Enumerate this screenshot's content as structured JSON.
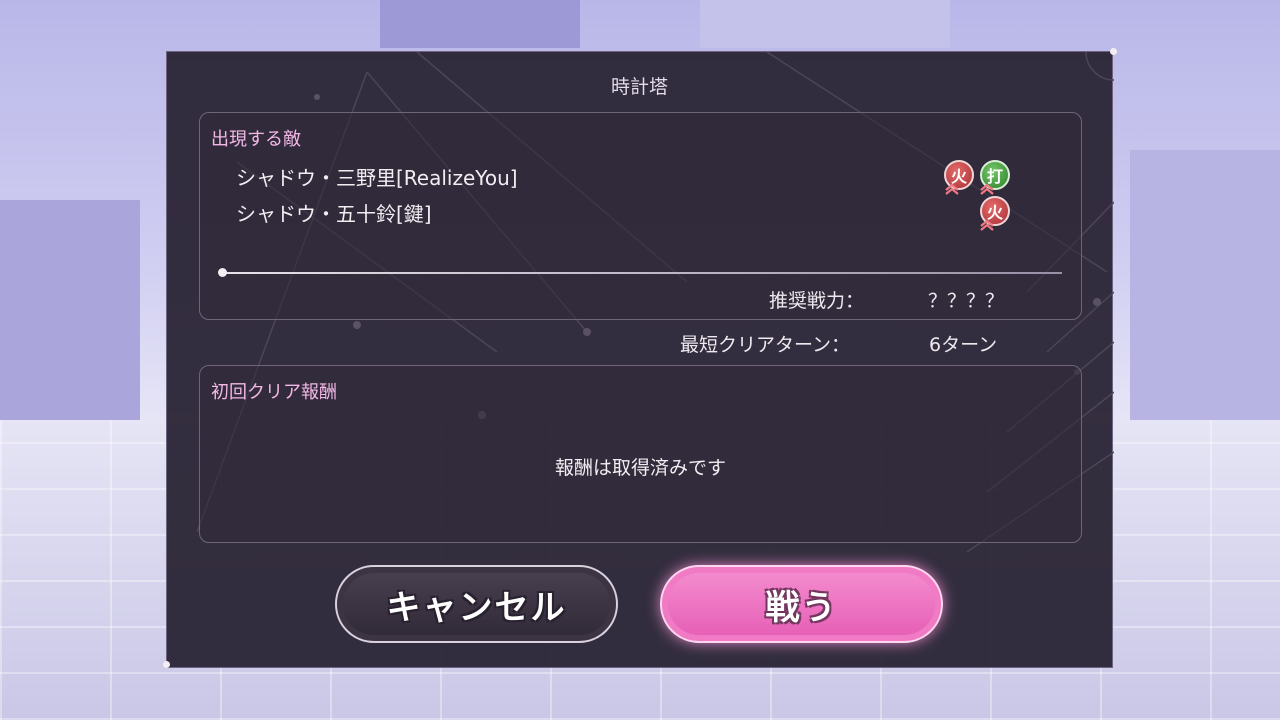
{
  "dialog": {
    "title": "時計塔",
    "enemies_label": "出現する敵",
    "enemies": [
      {
        "name": "シャドウ・三野里[RealizeYou]",
        "attributes": [
          {
            "glyph": "火",
            "type": "fire",
            "weak": true
          },
          {
            "glyph": "打",
            "type": "strike",
            "weak": true
          }
        ]
      },
      {
        "name": "シャドウ・五十鈴[鍵]",
        "attributes": [
          {
            "glyph": "火",
            "type": "fire",
            "weak": true
          }
        ]
      }
    ],
    "recommended_power_label": "推奨戦力：",
    "recommended_power_value": "？？？？",
    "shortest_clear_label": "最短クリアターン：",
    "shortest_clear_value": "6ターン",
    "first_reward_label": "初回クリア報酬",
    "first_reward_message": "報酬は取得済みです"
  },
  "buttons": {
    "cancel_label": "キャンセル",
    "fight_label": "戦う"
  },
  "colors": {
    "panel_bg": "#262030",
    "section_label": "#f3b8e6",
    "fight_button": "#e55cb5",
    "fire_attr": "#a72f34",
    "strike_attr": "#2f7f2c"
  }
}
